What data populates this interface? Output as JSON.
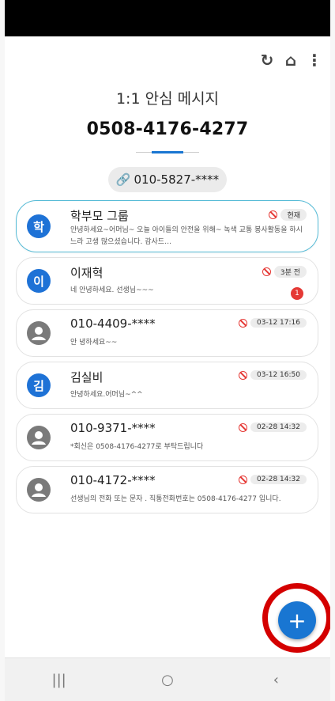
{
  "topbar": {
    "refresh_icon": "↻",
    "home_icon": "⌂",
    "more_icon": "⋮"
  },
  "header": {
    "title": "1:1 안심 메시지",
    "number": "0508-4176-4277",
    "link_icon": "🔗",
    "linked_number": "010-5827-****"
  },
  "conversations": [
    {
      "avatar": "학",
      "name": "학부모 그룹",
      "time": "현재",
      "message": "안녕하세요~어머님~ 오늘 아이들의 안전을 위해~ 녹색 교통 봉사활동을 하시느라 고생 많으셨습니다. 감사드…"
    },
    {
      "avatar": "이",
      "name": "이재혁",
      "time": "3분 전",
      "unread": "1",
      "message": "네 안녕하세요. 선생님~~~"
    },
    {
      "avatar": "",
      "name": "010-4409-****",
      "time": "03-12 17:16",
      "message": "안 녕하세요~~"
    },
    {
      "avatar": "김",
      "name": "김실비",
      "time": "03-12 16:50",
      "message": "안녕하세요.어머님~^^"
    },
    {
      "avatar": "",
      "name": "010-9371-****",
      "time": "02-28 14:32",
      "message": "*회신은 0508-4176-4277로 부탁드립니다"
    },
    {
      "avatar": "",
      "name": "010-4172-****",
      "time": "02-28 14:32",
      "message": "선생님의 전화 또는 문자 . 직통전화번호는 0508-4176-4277 입니다."
    }
  ],
  "fab": {
    "label": "+"
  },
  "navbar": {
    "recents": "|||",
    "home": "○",
    "back": "‹"
  },
  "colors": {
    "accent": "#1976d2",
    "highlight_ring": "#d40000",
    "blocked": "#e53935"
  }
}
